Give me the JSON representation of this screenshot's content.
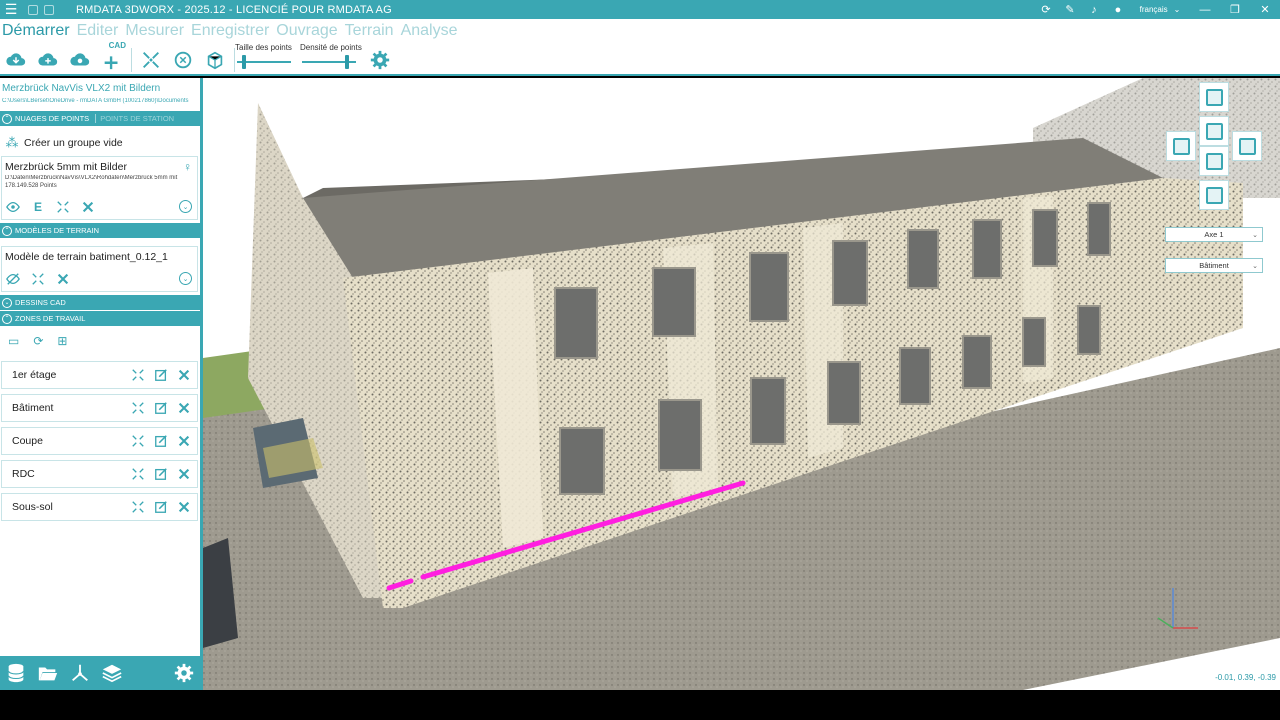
{
  "window": {
    "title": "RMDATA 3DWORX - 2025.12 - LICENCIÉ POUR RMDATA AG",
    "language": "français",
    "colors": {
      "accent": "#3aa7b3",
      "accent_dark": "#2c9aa8",
      "highlight_line": "#ff1ee0"
    }
  },
  "ribbon": {
    "tabs": [
      {
        "label": "Démarrer",
        "active": true
      },
      {
        "label": "Editer"
      },
      {
        "label": "Mesurer"
      },
      {
        "label": "Enregistrer"
      },
      {
        "label": "Ouvrage"
      },
      {
        "label": "Terrain"
      },
      {
        "label": "Analyse"
      }
    ],
    "cad_label": "CAD",
    "point_size_label": "Taille des points",
    "point_size_value": 0.1,
    "density_label": "Densité de points",
    "density_value": 0.85
  },
  "project": {
    "title": "Merzbrück NavVis VLX2 mit Bildern",
    "path": "C:\\Users\\LBerset\\OneDrive - rmDATA GmbH (100217860)\\Documents"
  },
  "sections": {
    "point_clouds": "NUAGES DE POINTS",
    "station_points": "POINTS DE STATION",
    "create_group": "Créer un groupe vide",
    "terrain_models": "MODÈLES DE TERRAIN",
    "cad_drawings": "DESSINS CAD",
    "work_zones": "ZONES DE TRAVAIL"
  },
  "point_cloud": {
    "name": "Merzbrück 5mm mit Bilder",
    "path": "D:\\Daten\\Merzbrück\\NavVis\\VLX2\\Rohdaten\\Merzbrück 5mm mit",
    "points": "178.149.528 Points",
    "edit_letter": "E"
  },
  "terrain_model": {
    "name": "Modèle de terrain batiment_0.12_1"
  },
  "work_zones": [
    {
      "label": "1er étage"
    },
    {
      "label": "Bâtiment"
    },
    {
      "label": "Coupe"
    },
    {
      "label": "RDC"
    },
    {
      "label": "Sous-sol"
    }
  ],
  "viewport": {
    "axis_select": "Axe 1",
    "zone_select": "Bâtiment",
    "coords": "-0.01, 0.39, -0.39"
  }
}
